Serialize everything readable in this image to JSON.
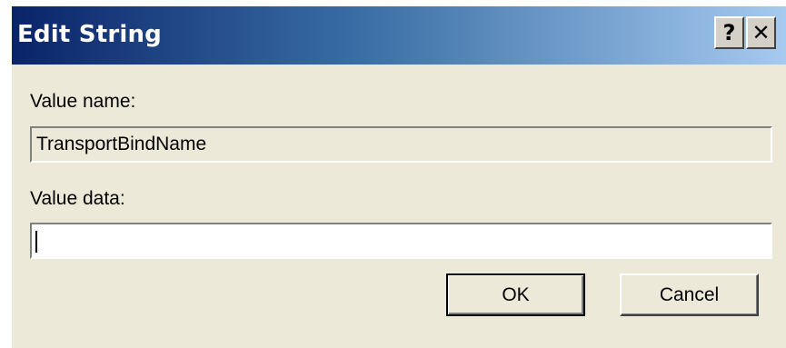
{
  "window": {
    "title": "Edit String",
    "help_button": "?",
    "close_button": "✕"
  },
  "form": {
    "value_name_label": "Value name:",
    "value_name": "TransportBindName",
    "value_data_label": "Value data:",
    "value_data": ""
  },
  "buttons": {
    "ok": "OK",
    "cancel": "Cancel"
  },
  "colors": {
    "titlebar_start": "#0a246a",
    "titlebar_end": "#a6caf0",
    "dialog_face": "#ece9d8"
  }
}
